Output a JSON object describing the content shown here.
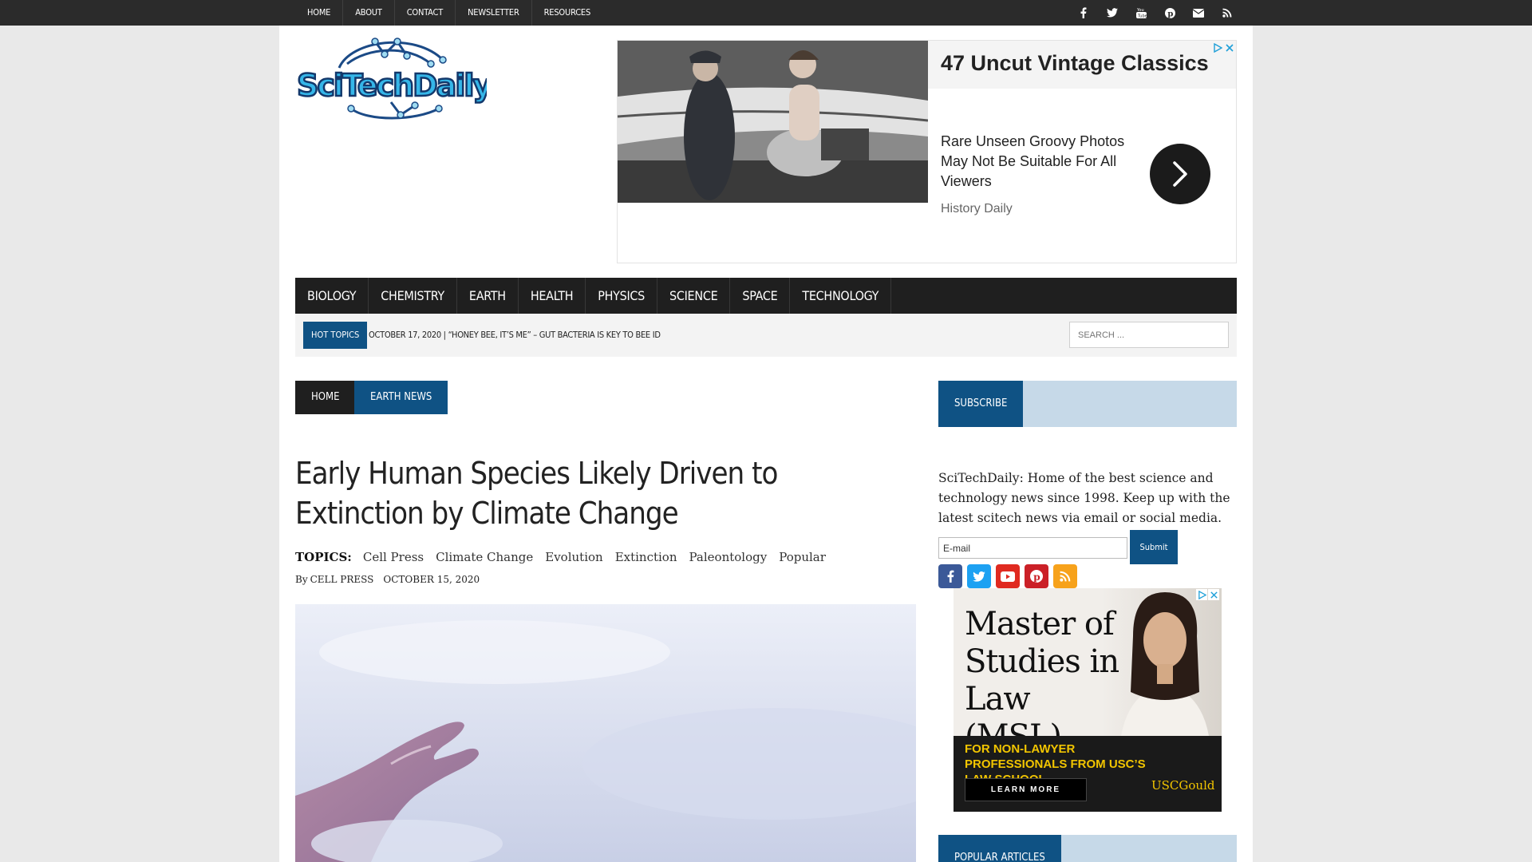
{
  "topnav": [
    "HOME",
    "ABOUT",
    "CONTACT",
    "NEWSLETTER",
    "RESOURCES"
  ],
  "social_icons": [
    "facebook-icon",
    "twitter-icon",
    "youtube-icon",
    "pinterest-icon",
    "email-icon",
    "rss-icon"
  ],
  "ad_top": {
    "title": "47 Uncut Vintage Classics",
    "description": "Rare Unseen Groovy Photos May Not Be Suitable For All Viewers",
    "source": "History Daily"
  },
  "mainnav": [
    "BIOLOGY",
    "CHEMISTRY",
    "EARTH",
    "HEALTH",
    "PHYSICS",
    "SCIENCE",
    "SPACE",
    "TECHNOLOGY"
  ],
  "hot_topics": {
    "label": "HOT TOPICS",
    "ticker": "OCTOBER 17, 2020  |  “HONEY BEE, IT’S ME” – GUT BACTERIA IS KEY TO BEE ID"
  },
  "search": {
    "placeholder": "SEARCH ..."
  },
  "breadcrumb": {
    "home": "HOME",
    "category": "EARTH NEWS"
  },
  "article": {
    "title": "Early Human Species Likely Driven to Extinction by Climate Change",
    "topics_label": "TOPICS:",
    "topics": [
      "Cell Press",
      "Climate Change",
      "Evolution",
      "Extinction",
      "Paleontology",
      "Popular"
    ],
    "byline_prefix": "By",
    "author": "CELL PRESS",
    "date": "OCTOBER 15, 2020"
  },
  "sidebar": {
    "subscribe_label": "SUBSCRIBE",
    "subscribe_text": "SciTechDaily: Home of the best science and technology news since 1998. Keep up with the latest scitech news via email or social media.",
    "email_value": "E-mail",
    "submit_label": "Submit",
    "social_icons": [
      "facebook-icon",
      "twitter-icon",
      "youtube-icon",
      "pinterest-icon",
      "rss-icon"
    ],
    "ad": {
      "headline": "Master of Studies in Law (MSL)",
      "tagline": "FOR NON-LAWYER PROFESSIONALS FROM USC’S LAW SCHOOL",
      "button": "LEARN MORE",
      "brand": "USCGould"
    },
    "popular_label": "POPULAR ARTICLES"
  },
  "colors": {
    "brand_blue": "#0f5284",
    "nav_dark": "#1f1f1f",
    "light_blue": "#c6d9e8"
  }
}
